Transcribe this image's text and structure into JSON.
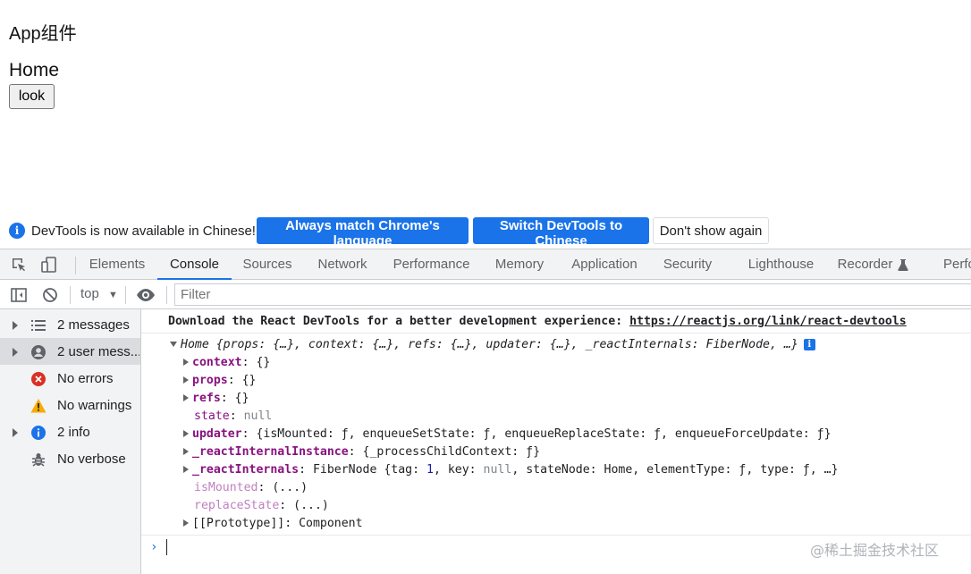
{
  "app": {
    "title": "App组件",
    "home_title": "Home",
    "look_button": "look"
  },
  "infobar": {
    "message": "DevTools is now available in Chinese!",
    "always_match": "Always match Chrome's language",
    "switch_chinese": "Switch DevTools to Chinese",
    "dont_show": "Don't show again"
  },
  "tabs": [
    {
      "label": "Elements"
    },
    {
      "label": "Console"
    },
    {
      "label": "Sources"
    },
    {
      "label": "Network"
    },
    {
      "label": "Performance"
    },
    {
      "label": "Memory"
    },
    {
      "label": "Application"
    },
    {
      "label": "Security"
    },
    {
      "label": "Lighthouse"
    },
    {
      "label": "Recorder"
    },
    {
      "label": "Perfo"
    }
  ],
  "console_toolbar": {
    "context": "top",
    "filter_placeholder": "Filter"
  },
  "sidebar": {
    "items": [
      {
        "label": "2 messages"
      },
      {
        "label": "2 user mess..."
      },
      {
        "label": "No errors"
      },
      {
        "label": "No warnings"
      },
      {
        "label": "2 info"
      },
      {
        "label": "No verbose"
      }
    ]
  },
  "console": {
    "download_text": "Download the React DevTools for a better development experience: ",
    "download_link": "https://reactjs.org/link/react-devtools",
    "home_name": "Home",
    "home_summary": " {props: {…}, context: {…}, refs: {…}, updater: {…}, _reactInternals: FiberNode, …}",
    "info_badge": "i",
    "context_key": "context",
    "context_val": ": {}",
    "props_key": "props",
    "props_val": ": {}",
    "refs_key": "refs",
    "refs_val": ": {}",
    "state_key": "state",
    "state_colon": ": ",
    "state_val": "null",
    "updater_key": "updater",
    "updater_val": ": {isMounted: ƒ, enqueueSetState: ƒ, enqueueReplaceState: ƒ, enqueueForceUpdate: ƒ}",
    "rri_key": "_reactInternalInstance",
    "rri_val": ": {_processChildContext: ƒ}",
    "ri_key": "_reactInternals",
    "ri_val_a": ": FiberNode {tag: ",
    "ri_tag": "1",
    "ri_val_b": ", key: ",
    "ri_key_val": "null",
    "ri_val_c": ", stateNode: Home, elementType: ƒ, type: ƒ, …}",
    "ismounted_key": "isMounted",
    "ismounted_val": ": (...)",
    "replacestate_key": "replaceState",
    "replacestate_val": ": (...)",
    "prototype": "[[Prototype]]",
    "prototype_val": ": Component",
    "prompt": "›"
  },
  "watermark": "@稀土掘金技术社区",
  "colors": {
    "accent": "#1a73e8",
    "error": "#d93025",
    "warning": "#f9ab00"
  }
}
